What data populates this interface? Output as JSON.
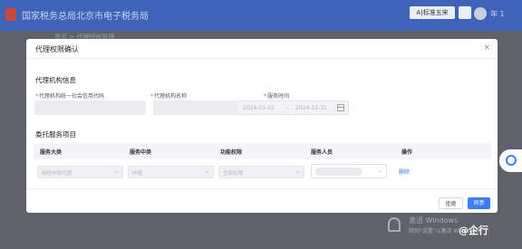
{
  "topbar": {
    "app_title": "国家税务总局北京市电子税务局",
    "font_switch": "A|标准五宋",
    "user_name": "年 1"
  },
  "subrow": "首页 > 代理授权管理",
  "modal": {
    "title": "代理权限确认",
    "close": "×",
    "agency_section": "代理机构信息",
    "fields": {
      "credit_code_label": "代理机构统一社会信用代码",
      "name_label": "代理机构名称",
      "service_time_label": "服务时间",
      "date_start": "2024-01-01",
      "date_sep": "-",
      "date_end": "2024-12-31"
    },
    "service_section": "委托服务项目",
    "table": {
      "headers": [
        "服务大类",
        "服务中类",
        "功能权限",
        "服务人员",
        "操作"
      ],
      "row": {
        "category": "纳税申报代理",
        "subcategory": "申报",
        "permission": "全部权限",
        "action": "删除"
      }
    },
    "buttons": {
      "reject": "拒绝",
      "agree": "同意"
    }
  },
  "overlay": {
    "watermark": "激活 Windows",
    "watermark_sub": "转到\"设置\"以激活 Windows。",
    "corner_logo": "@企行"
  }
}
